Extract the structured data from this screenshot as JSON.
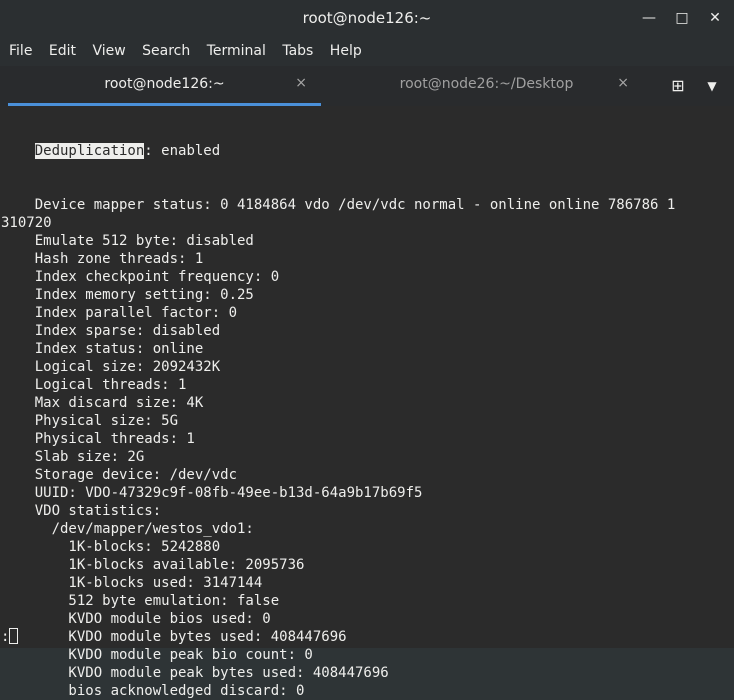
{
  "window": {
    "title": "root@node126:~",
    "minimize_glyph": "—",
    "maximize_glyph": "□",
    "close_glyph": "✕"
  },
  "menu": [
    "File",
    "Edit",
    "View",
    "Search",
    "Terminal",
    "Tabs",
    "Help"
  ],
  "tabs": [
    {
      "label": "root@node126:~",
      "close": "×",
      "active": true
    },
    {
      "label": "root@node26:~/Desktop",
      "close": "×",
      "active": false
    }
  ],
  "tab_controls": {
    "new_tab_glyph": "⊞",
    "menu_glyph": "▼"
  },
  "terminal": {
    "selected_word": "Deduplication",
    "first_line_rest": ": enabled",
    "lines": [
      "    Device mapper status: 0 4184864 vdo /dev/vdc normal - online online 786786 1",
      "310720",
      "    Emulate 512 byte: disabled",
      "    Hash zone threads: 1",
      "    Index checkpoint frequency: 0",
      "    Index memory setting: 0.25",
      "    Index parallel factor: 0",
      "    Index sparse: disabled",
      "    Index status: online",
      "    Logical size: 2092432K",
      "    Logical threads: 1",
      "    Max discard size: 4K",
      "    Physical size: 5G",
      "    Physical threads: 1",
      "    Slab size: 2G",
      "    Storage device: /dev/vdc",
      "    UUID: VDO-47329c9f-08fb-49ee-b13d-64a9b17b69f5",
      "    VDO statistics:",
      "      /dev/mapper/westos_vdo1:",
      "        1K-blocks: 5242880",
      "        1K-blocks available: 2095736",
      "        1K-blocks used: 3147144",
      "        512 byte emulation: false",
      "        KVDO module bios used: 0",
      "        KVDO module bytes used: 408447696",
      "        KVDO module peak bio count: 0",
      "        KVDO module peak bytes used: 408447696",
      "        bios acknowledged discard: 0"
    ],
    "prompt": ":"
  }
}
